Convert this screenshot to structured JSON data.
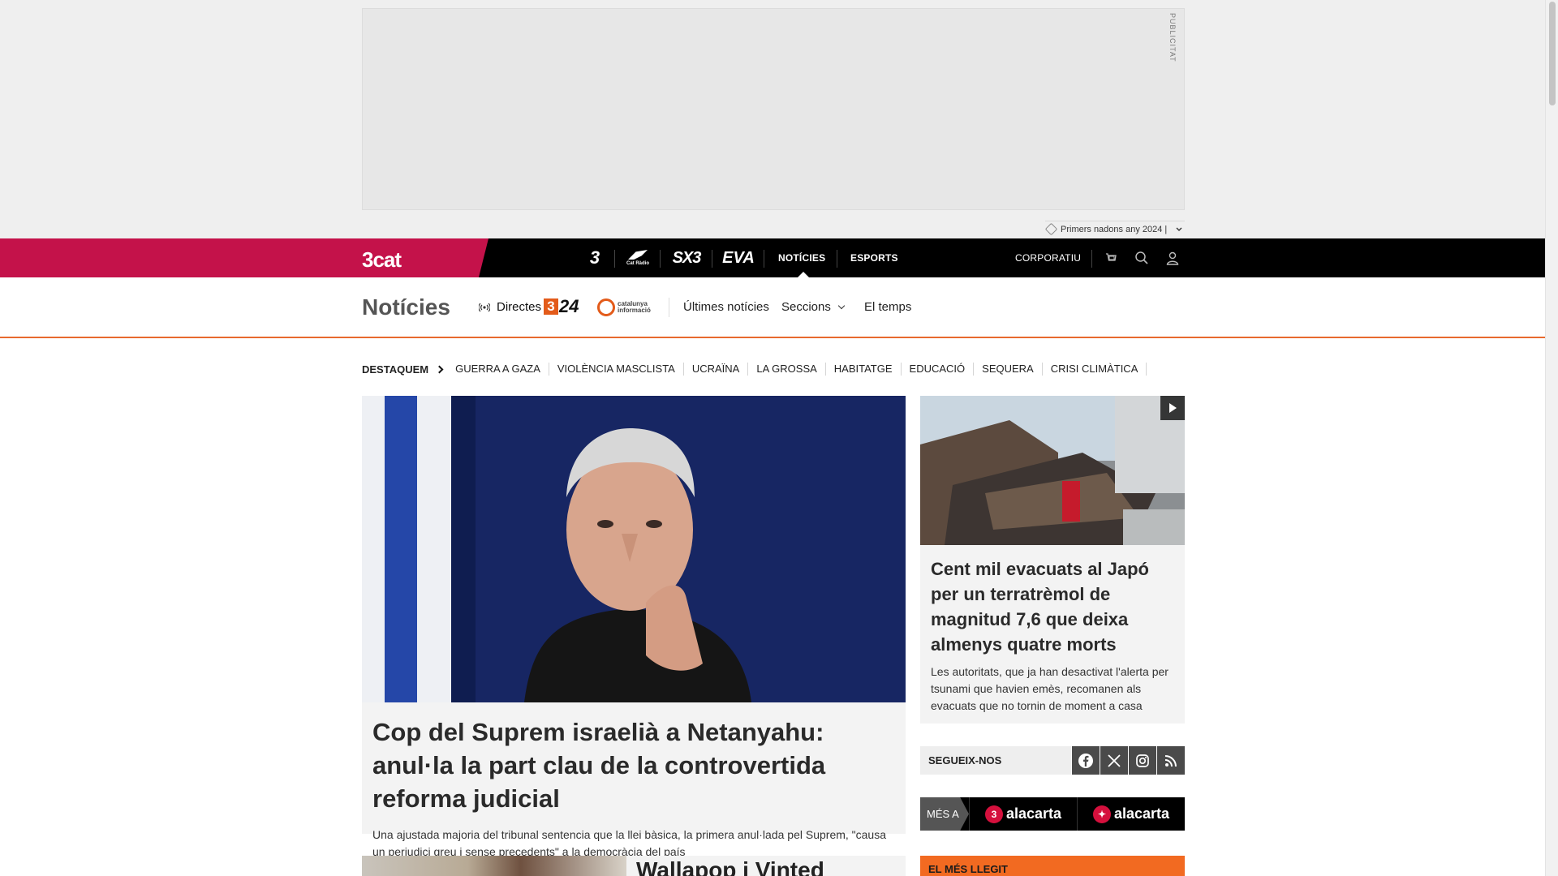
{
  "ad": {
    "label": "PUBLICITAT",
    "promo_text": "Primers nadons any 2024 |"
  },
  "topbar": {
    "brand": "3cat",
    "channels": [
      "3",
      "Cat Ràdio",
      "SX3",
      "EVA"
    ],
    "nav": {
      "noticies": "NOTÍCIES",
      "esports": "ESPORTS",
      "corporatiu": "CORPORATIU"
    },
    "colors": {
      "brand": "#c4124a",
      "bar": "#000000"
    },
    "icons": [
      "cart-icon",
      "search-icon",
      "user-icon"
    ]
  },
  "section": {
    "title": "Notícies",
    "live_label": "Directes",
    "links": [
      "Últimes notícies",
      "Seccions",
      "El temps"
    ],
    "accent": "#e86a2e"
  },
  "destaquem": {
    "label": "DESTAQUEM",
    "tags": [
      "GUERRA A GAZA",
      "VIOLÈNCIA MASCLISTA",
      "UCRAÏNA",
      "LA GROSSA",
      "HABITATGE",
      "EDUCACIÓ",
      "SEQUERA",
      "CRISI CLIMÀTICA"
    ]
  },
  "main_article": {
    "title": "Cop del Suprem israelià a Netanyahu: anul·la la part clau de la controvertida reforma judicial",
    "summary": "Una ajustada majoria del tribunal sentencia que la llei bàsica, la primera anul·lada pel Suprem, \"causa un perjudici greu i sense precedents\" a la democràcia del país"
  },
  "side_article": {
    "title": "Cent mil evacuats al Japó per un terratrèmol de magnitud 7,6 que deixa almenys quatre morts",
    "summary": "Les autoritats, que ja han desactivat l'alerta per tsunami que havien emès, recomanen als evacuats que no tornin de moment a casa"
  },
  "follow": {
    "label": "SEGUEIX-NOS",
    "networks": [
      "facebook-icon",
      "x-icon",
      "instagram-icon",
      "rss-icon"
    ]
  },
  "alacarta": {
    "prefix": "MÉS A",
    "brands": [
      "alacarta",
      "alacarta"
    ]
  },
  "next": {
    "title": "Wallapop i Vinted",
    "most_read_label": "EL MÉS LLEGIT"
  }
}
